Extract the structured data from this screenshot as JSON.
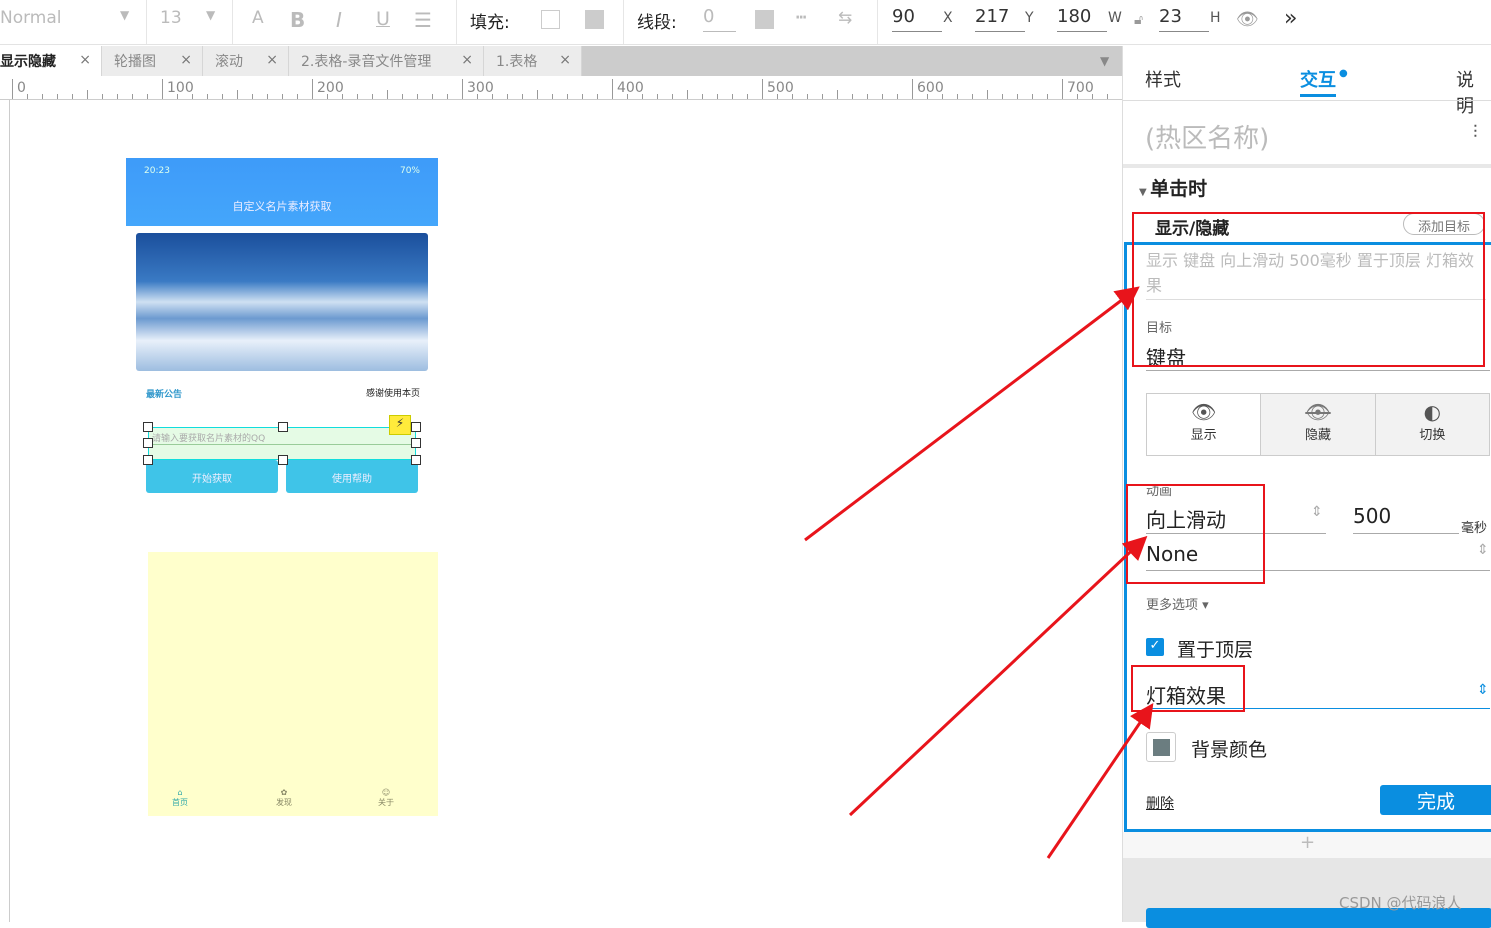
{
  "toolbar": {
    "font_style": "Normal",
    "font_size": "13",
    "fill_label": "填充:",
    "stroke_label": "线段:",
    "stroke_value": "0",
    "x": "90",
    "x_label": "X",
    "y": "217",
    "y_label": "Y",
    "w": "180",
    "w_label": "W",
    "h": "23",
    "h_label": "H"
  },
  "tabs": [
    {
      "label": "显示隐藏",
      "active": true
    },
    {
      "label": "轮播图"
    },
    {
      "label": "滚动"
    },
    {
      "label": "2.表格-录音文件管理"
    },
    {
      "label": "1.表格"
    }
  ],
  "ruler": [
    "0",
    "100",
    "200",
    "300",
    "400",
    "500",
    "600",
    "700"
  ],
  "mockup": {
    "status_time": "20:23",
    "battery": "70%",
    "title": "自定义名片素材获取",
    "notice_left": "最新公告",
    "notice_right": "感谢使用本页",
    "input_placeholder": "请输入要获取名片素材的QQ",
    "btn_start": "开始获取",
    "btn_help": "使用帮助",
    "nav": [
      "首页",
      "发现",
      "关于"
    ]
  },
  "panel": {
    "tabs": [
      "样式",
      "交互",
      "说明"
    ],
    "active_tab": "交互",
    "hotspot_name": "(热区名称)",
    "event": "单击时",
    "action": "显示/隐藏",
    "add_target": "添加目标",
    "summary": "显示 键盘 向上滑动 500毫秒 置于顶层 灯箱效果",
    "target_label": "目标",
    "target_value": "键盘",
    "vis_buttons": [
      "显示",
      "隐藏",
      "切换"
    ],
    "anim_label": "动画",
    "anim_value": "向上滑动",
    "duration": "500",
    "duration_unit": "毫秒",
    "anim2_value": "None",
    "more_options": "更多选项 ▾",
    "bring_to_front": "置于顶层",
    "bring_to_front_checked": true,
    "lightbox": "灯箱效果",
    "bg_color": "背景颜色",
    "delete": "删除",
    "done": "完成",
    "add": "+"
  },
  "watermark": "CSDN @代码浪人",
  "colors": {
    "accent": "#0a8ee0",
    "annotation": "#e8141b",
    "mock_header": "#3e9bf9",
    "mock_button": "#3fc4e8",
    "mock_yellow": "#ffffcc"
  }
}
